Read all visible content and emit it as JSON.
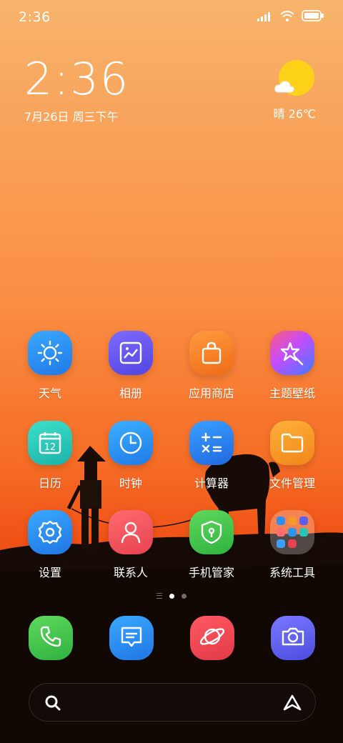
{
  "status_bar": {
    "time": "2:36",
    "icons": [
      "signal-icon",
      "wifi-icon",
      "battery-icon"
    ]
  },
  "clock_widget": {
    "time": "2:36",
    "date": "7月26日 周三下午"
  },
  "weather_widget": {
    "condition": "晴",
    "temperature": "26℃",
    "text": "晴 26℃",
    "icon": "sun-cloud-icon"
  },
  "apps": [
    {
      "label": "天气",
      "icon": "sun-icon",
      "color": "#2f8ff0"
    },
    {
      "label": "相册",
      "icon": "gallery-icon",
      "color": "#6b5cf0"
    },
    {
      "label": "应用商店",
      "icon": "shopping-bag-icon",
      "color": "#f07c2a"
    },
    {
      "label": "主题壁纸",
      "icon": "theme-star-icon",
      "color": "#e0488a"
    },
    {
      "label": "日历",
      "icon": "calendar-icon",
      "color": "#27c5b8"
    },
    {
      "label": "时钟",
      "icon": "clock-icon",
      "color": "#2c95ee"
    },
    {
      "label": "计算器",
      "icon": "calculator-icon",
      "color": "#2f86f0"
    },
    {
      "label": "文件管理",
      "icon": "folder-icon",
      "color": "#f39a2b"
    },
    {
      "label": "设置",
      "icon": "gear-icon",
      "color": "#2f8ff0"
    },
    {
      "label": "联系人",
      "icon": "person-icon",
      "color": "#f05a5e"
    },
    {
      "label": "手机管家",
      "icon": "shield-icon",
      "color": "#3dc447"
    },
    {
      "label": "系统工具",
      "icon": "folder-grid-icon",
      "color": "#ffffff"
    }
  ],
  "calendar_day": "12",
  "dock": [
    {
      "name": "phone",
      "icon": "phone-icon",
      "color": "#3dc447"
    },
    {
      "name": "messages",
      "icon": "message-icon",
      "color": "#2f8ff0"
    },
    {
      "name": "browser",
      "icon": "planet-icon",
      "color": "#e8424f"
    },
    {
      "name": "camera",
      "icon": "camera-icon",
      "color": "#5b5ff0"
    }
  ],
  "pager": {
    "pages": 2,
    "current": 1
  },
  "search_bar": {
    "left_icon": "search-icon",
    "right_icon": "assistant-icon"
  }
}
